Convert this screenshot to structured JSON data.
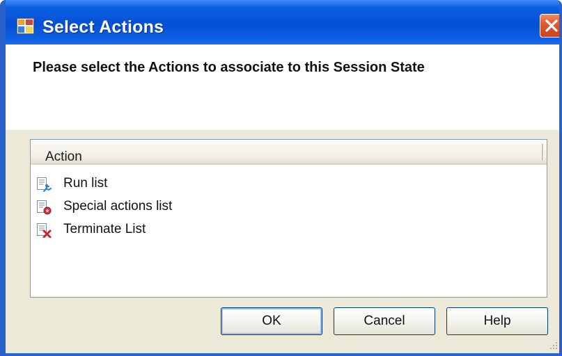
{
  "window": {
    "title": "Select Actions",
    "accent_color": "#0a5fe0"
  },
  "header": {
    "instruction": "Please select the Actions to associate to this Session State"
  },
  "list": {
    "column_header": "Action",
    "items": [
      {
        "label": "Run list",
        "icon": "run-list-icon"
      },
      {
        "label": "Special actions list",
        "icon": "special-actions-list-icon"
      },
      {
        "label": "Terminate List",
        "icon": "terminate-list-icon"
      }
    ]
  },
  "buttons": {
    "ok": "OK",
    "cancel": "Cancel",
    "help": "Help"
  }
}
